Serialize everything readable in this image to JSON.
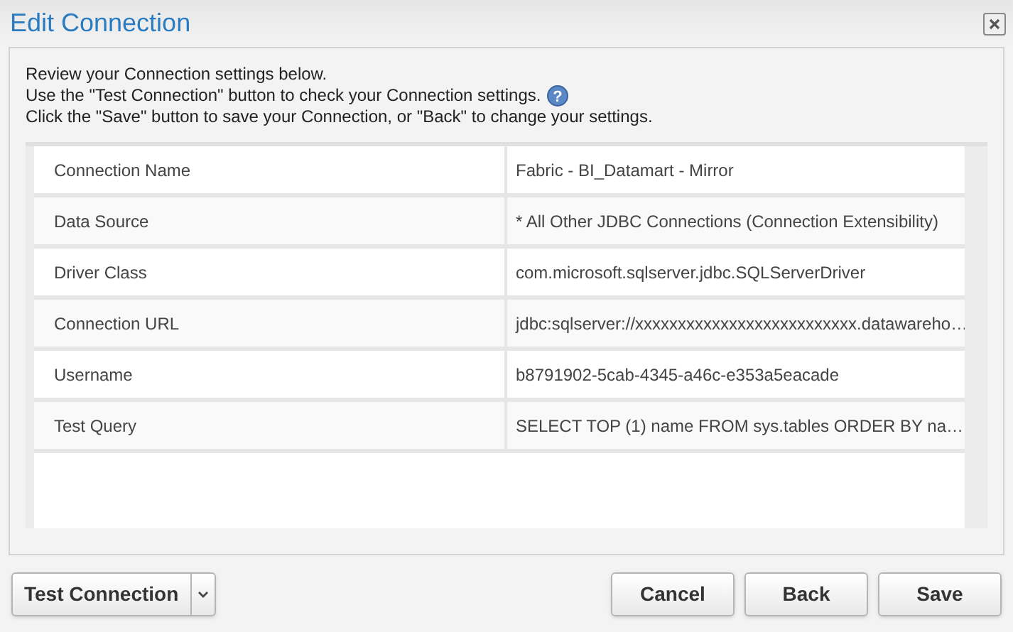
{
  "window": {
    "title": "Edit Connection"
  },
  "intro": [
    "Review your Connection settings below.",
    "Use the \"Test Connection\" button to check your Connection settings.",
    "Click the \"Save\" button to save your Connection, or \"Back\" to change your settings."
  ],
  "help_icon": "?",
  "table": {
    "rows": [
      {
        "label": "Connection Name",
        "value": "Fabric - BI_Datamart - Mirror"
      },
      {
        "label": "Data Source",
        "value": "* All Other JDBC Connections (Connection Extensibility)"
      },
      {
        "label": "Driver Class",
        "value": "com.microsoft.sqlserver.jdbc.SQLServerDriver"
      },
      {
        "label": "Connection URL",
        "value": "jdbc:sqlserver://xxxxxxxxxxxxxxxxxxxxxxxxxx.datawareho…"
      },
      {
        "label": "Username",
        "value": "b8791902-5cab-4345-a46c-e353a5eacade"
      },
      {
        "label": "Test Query",
        "value": "SELECT TOP (1) name FROM sys.tables ORDER BY na…"
      }
    ]
  },
  "buttons": {
    "test": "Test Connection",
    "actions": [
      "Cancel",
      "Back",
      "Save"
    ]
  }
}
